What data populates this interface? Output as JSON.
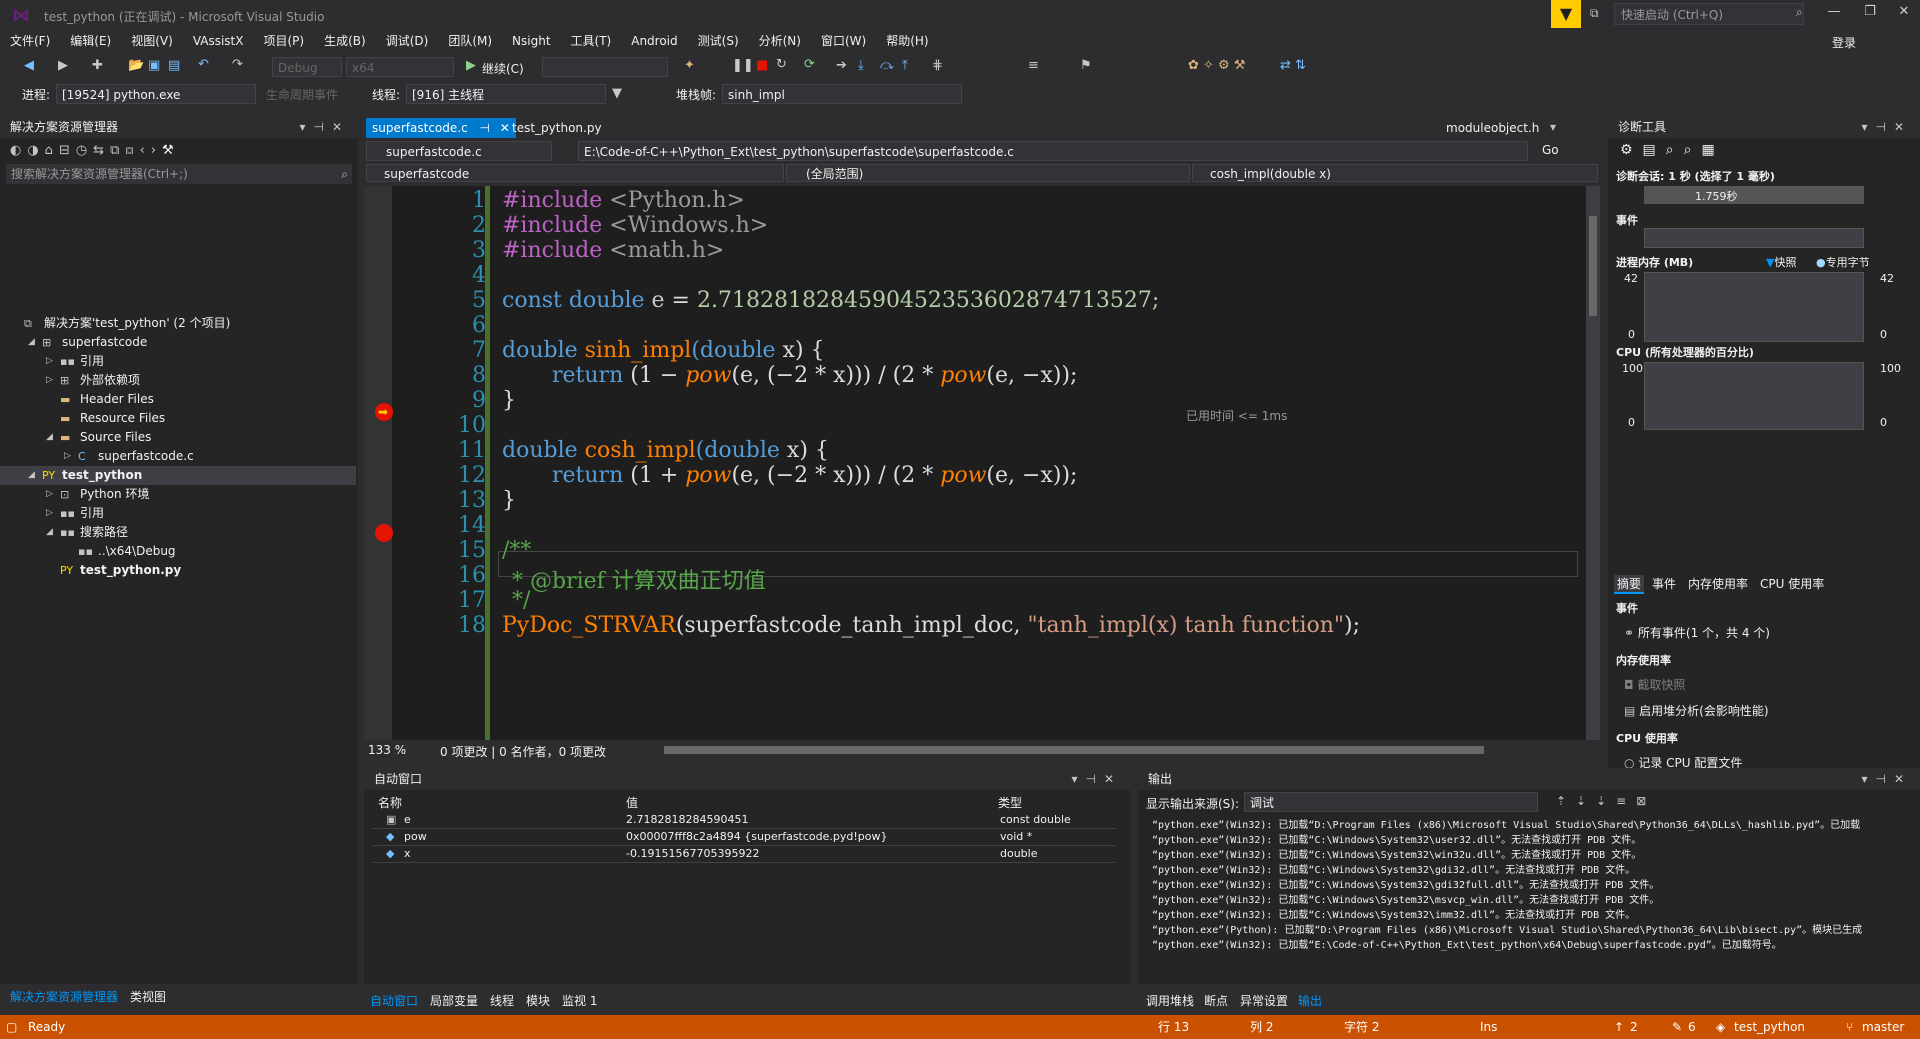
{
  "window": {
    "title": "test_python (正在调试) - Microsoft Visual Studio",
    "quick_launch_placeholder": "快速启动 (Ctrl+Q)",
    "login": "登录"
  },
  "menu": [
    "文件(F)",
    "编辑(E)",
    "视图(V)",
    "VAssistX",
    "项目(P)",
    "生成(B)",
    "调试(D)",
    "团队(M)",
    "Nsight",
    "工具(T)",
    "Android",
    "测试(S)",
    "分析(N)",
    "窗口(W)",
    "帮助(H)"
  ],
  "toolbar": {
    "config": "Debug",
    "platform": "x64",
    "continue": "继续(C)",
    "process_label": "进程:",
    "process": "[19524] python.exe",
    "lifecycle": "生命周期事件",
    "thread_label": "线程:",
    "thread": "[916] 主线程",
    "stackframe_label": "堆栈帧:",
    "stackframe": "sinh_impl"
  },
  "solution_explorer": {
    "title": "解决方案资源管理器",
    "search_placeholder": "搜索解决方案资源管理器(Ctrl+;)",
    "tree": [
      {
        "label": "解决方案'test_python' (2 个项目)",
        "icon": "solution-icon",
        "indent": 0,
        "bold": false
      },
      {
        "label": "superfastcode",
        "icon": "cpp-project-icon",
        "indent": 1,
        "bold": false
      },
      {
        "label": "引用",
        "icon": "references-icon",
        "indent": 2,
        "bold": false
      },
      {
        "label": "外部依赖项",
        "icon": "external-deps-icon",
        "indent": 2,
        "bold": false
      },
      {
        "label": "Header Files",
        "icon": "folder-icon",
        "indent": 2,
        "bold": false
      },
      {
        "label": "Resource Files",
        "icon": "folder-icon",
        "indent": 2,
        "bold": false
      },
      {
        "label": "Source Files",
        "icon": "folder-icon",
        "indent": 2,
        "bold": false
      },
      {
        "label": "superfastcode.c",
        "icon": "c-file-icon",
        "indent": 3,
        "bold": false
      },
      {
        "label": "test_python",
        "icon": "python-project-icon",
        "indent": 1,
        "bold": true
      },
      {
        "label": "Python 环境",
        "icon": "python-env-icon",
        "indent": 2,
        "bold": false
      },
      {
        "label": "引用",
        "icon": "references-icon",
        "indent": 2,
        "bold": false
      },
      {
        "label": "搜索路径",
        "icon": "search-path-icon",
        "indent": 2,
        "bold": false
      },
      {
        "label": "..\\x64\\Debug",
        "icon": "path-icon",
        "indent": 3,
        "bold": false
      },
      {
        "label": "test_python.py",
        "icon": "python-file-icon",
        "indent": 2,
        "bold": true
      }
    ],
    "bottom_tabs": [
      "解决方案资源管理器",
      "类视图"
    ]
  },
  "editor": {
    "tabs": [
      "superfastcode.c",
      "test_python.py"
    ],
    "right_tab": "moduleobject.h",
    "nav_file": "superfastcode.c",
    "path": "E:\\Code-of-C++\\Python_Ext\\test_python\\superfastcode\\superfastcode.c",
    "go": "Go",
    "nav_project": "superfastcode",
    "nav_scope": "(全局范围)",
    "nav_func": "cosh_impl(double x)",
    "time_hint": "已用时间 <= 1ms",
    "zoom": "133 %",
    "changes": "0 项更改 | 0 名作者，0 项更改",
    "line_numbers": [
      "1",
      "2",
      "3",
      "4",
      "5",
      "6",
      "7",
      "8",
      "9",
      "10",
      "11",
      "12",
      "13",
      "14",
      "15",
      "16",
      "17",
      "18"
    ],
    "code": {
      "l1a": "#include",
      "l1b": "<Python.h>",
      "l2a": "#include",
      "l2b": "<Windows.h>",
      "l3a": "#include",
      "l3b": "<math.h>",
      "l5a": "const",
      "l5b": "double",
      "l5c": "e",
      "l5d": "=",
      "l5e": "2.718281828459045235360287471352",
      "l5f": "7;",
      "l7a": "double",
      "l7b": "sinh_impl",
      "l7c": "(double",
      "l7d": "x)",
      "l7e": "{",
      "l8a": "return",
      "l8b": "(1",
      "l8c": "−",
      "l8d": "pow",
      "l8e": "(e,",
      "l8f": "(−2",
      "l8g": "*",
      "l8h": "x)))",
      "l8i": "/",
      "l8j": "(2",
      "l8k": "*",
      "l8l": "pow",
      "l8m": "(e,",
      "l8n": "−x));",
      "l9": "}",
      "l11a": "double",
      "l11b": "cosh_impl",
      "l11c": "(double",
      "l11d": "x)",
      "l11e": "{",
      "l12a": "return",
      "l12b": "(1",
      "l12c": "+",
      "l12d": "pow",
      "l12e": "(e,",
      "l12f": "(−2",
      "l12g": "*",
      "l12h": "x)))",
      "l12i": "/",
      "l12j": "(2",
      "l12k": "*",
      "l12l": "pow",
      "l12m": "(e,",
      "l12n": "−x));",
      "l13": "}",
      "l15": "/**",
      "l16": "* @brief 计算双曲正切值",
      "l17": "*/",
      "l18a": "PyDoc_STRVAR",
      "l18b": "(superfastcode_tanh_impl_doc,",
      "l18c": "\"tanh_impl(x)",
      "l18d": "tanh function\"",
      "l18e": ");"
    }
  },
  "diagnostics": {
    "title": "诊断工具",
    "session": "诊断会话: 1 秒 (选择了 1 毫秒)",
    "time_label": "1.759秒",
    "events_label": "事件",
    "memory_label": "进程内存 (MB)",
    "legend_snapshot": "快照",
    "legend_private": "专用字节",
    "mem_max": "42",
    "mem_min": "0",
    "cpu_label": "CPU (所有处理器的百分比)",
    "cpu_max": "100",
    "cpu_min": "0",
    "subtabs": [
      "摘要",
      "事件",
      "内存使用率",
      "CPU 使用率"
    ],
    "events_heading": "事件",
    "events_all": "所有事件(1 个，共 4 个)",
    "mem_heading": "内存使用率",
    "take_snapshot": "截取快照",
    "heap_profiling": "启用堆分析(会影响性能)",
    "cpu_heading": "CPU 使用率",
    "record_cpu": "记录 CPU 配置文件",
    "colors": {
      "accent": "#0097fb",
      "graph_bg": "#3f3f46"
    }
  },
  "autos": {
    "title": "自动窗口",
    "columns": [
      "名称",
      "值",
      "类型"
    ],
    "rows": [
      {
        "name": "e",
        "value": "2.7182818284590451",
        "type": "const double"
      },
      {
        "name": "pow",
        "value": "0x00007fff8c2a4894 {superfastcode.pyd!pow}",
        "type": "void *"
      },
      {
        "name": "x",
        "value": "-0.19151567705395922",
        "type": "double"
      }
    ],
    "bottom_tabs": [
      "自动窗口",
      "局部变量",
      "线程",
      "模块",
      "监视 1"
    ]
  },
  "output": {
    "title": "输出",
    "source_label": "显示输出来源(S):",
    "source": "调试",
    "lines": [
      "“python.exe”(Win32): 已加载“D:\\Program Files (x86)\\Microsoft Visual Studio\\Shared\\Python36_64\\DLLs\\_hashlib.pyd”。已加载",
      "“python.exe”(Win32): 已加载“C:\\Windows\\System32\\user32.dll”。无法查找或打开 PDB 文件。",
      "“python.exe”(Win32): 已加载“C:\\Windows\\System32\\win32u.dll”。无法查找或打开 PDB 文件。",
      "“python.exe”(Win32): 已加载“C:\\Windows\\System32\\gdi32.dll”。无法查找或打开 PDB 文件。",
      "“python.exe”(Win32): 已加载“C:\\Windows\\System32\\gdi32full.dll”。无法查找或打开 PDB 文件。",
      "“python.exe”(Win32): 已加载“C:\\Windows\\System32\\msvcp_win.dll”。无法查找或打开 PDB 文件。",
      "“python.exe”(Win32): 已加载“C:\\Windows\\System32\\imm32.dll”。无法查找或打开 PDB 文件。",
      "“python.exe”(Python): 已加载“D:\\Program Files (x86)\\Microsoft Visual Studio\\Shared\\Python36_64\\Lib\\bisect.py”。模块已生成",
      "“python.exe”(Win32): 已加载“E:\\Code-of-C++\\Python_Ext\\test_python\\x64\\Debug\\superfastcode.pyd”。已加载符号。"
    ],
    "bottom_tabs": [
      "调用堆栈",
      "断点",
      "异常设置",
      "输出"
    ]
  },
  "statusbar": {
    "ready": "Ready",
    "line": "行 13",
    "col": "列 2",
    "char": "字符 2",
    "ins": "Ins",
    "up": "2",
    "edits": "6",
    "repo": "test_python",
    "branch": "master",
    "color": "#ca5100"
  }
}
